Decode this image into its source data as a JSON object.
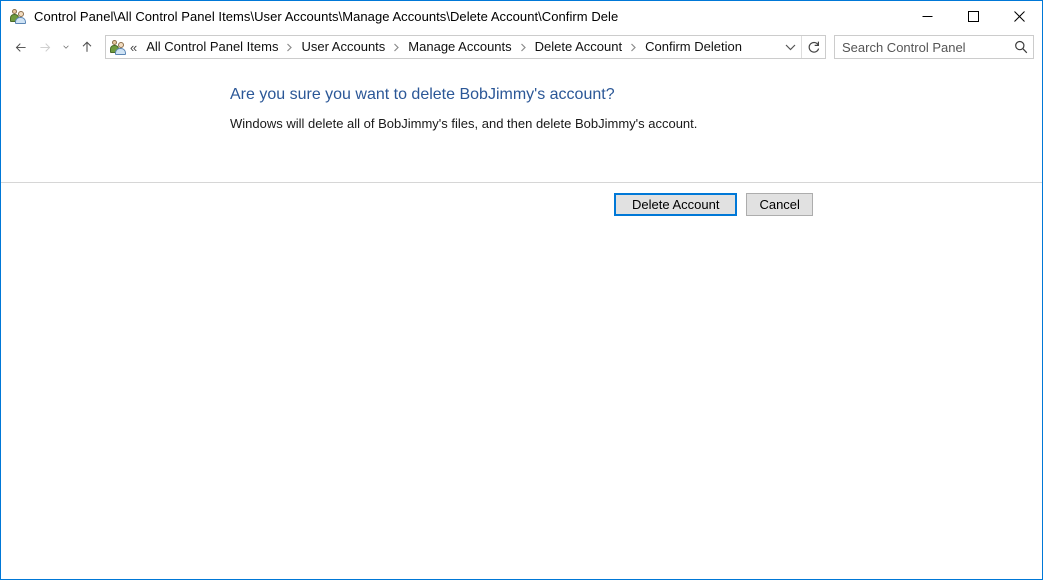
{
  "window": {
    "title": "Control Panel\\All Control Panel Items\\User Accounts\\Manage Accounts\\Delete Account\\Confirm Dele",
    "icon": "user-accounts-icon",
    "border_color": "#0078d7",
    "caption": {
      "minimize_label": "Minimize",
      "maximize_label": "Maximize",
      "close_label": "Close"
    }
  },
  "navbar": {
    "back_label": "Back",
    "forward_label": "Forward",
    "recent_label": "Recent locations",
    "up_label": "Up one level",
    "overflow": "«",
    "breadcrumbs": [
      {
        "label": "All Control Panel Items"
      },
      {
        "label": "User Accounts"
      },
      {
        "label": "Manage Accounts"
      },
      {
        "label": "Delete Account"
      },
      {
        "label": "Confirm Deletion"
      }
    ],
    "dropdown_label": "Previous locations",
    "refresh_label": "Refresh"
  },
  "search": {
    "placeholder": "Search Control Panel",
    "value": "",
    "icon": "search-icon"
  },
  "main": {
    "heading": "Are you sure you want to delete BobJimmy's account?",
    "heading_color": "#2b5797",
    "subtext": "Windows will delete all of BobJimmy's files, and then delete BobJimmy's account.",
    "buttons": {
      "delete_label": "Delete Account",
      "cancel_label": "Cancel",
      "focus_color": "#0078d7"
    }
  }
}
